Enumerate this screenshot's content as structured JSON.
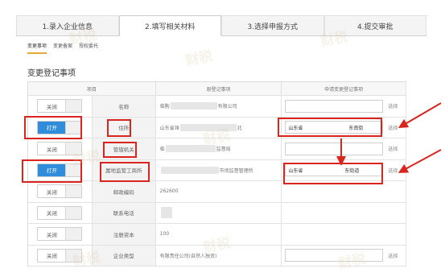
{
  "steps": [
    {
      "label": "1.录入企业信息",
      "active": false
    },
    {
      "label": "2.填写相关材料",
      "active": true
    },
    {
      "label": "3.选择申报方式",
      "active": false
    },
    {
      "label": "4.提交审批",
      "active": false
    }
  ],
  "subtabs": [
    {
      "label": "变更事项",
      "active": true
    },
    {
      "label": "变更备案",
      "active": false
    },
    {
      "label": "授权委托",
      "active": false
    }
  ],
  "section_title": "变更登记事项",
  "table": {
    "headers": [
      "项目",
      "原登记事项",
      "申请变更登记事项"
    ],
    "rows": [
      {
        "toggle": "关闭",
        "on": false,
        "field": "名称",
        "old": "临朐",
        "old_suffix": "有限公司",
        "new": "",
        "choose": "选择"
      },
      {
        "toggle": "打开",
        "on": true,
        "field": "住所",
        "old": "山东省潍",
        "old_suffix": "北",
        "new": "山东省",
        "new_suffix": "东南街",
        "choose": "选择"
      },
      {
        "toggle": "关闭",
        "on": false,
        "field": "管辖机关",
        "old": "临",
        "old_suffix": "监督局",
        "new": "",
        "choose": "选择"
      },
      {
        "toggle": "打开",
        "on": true,
        "field": "属地监管工商所",
        "old": "",
        "old_suffix": "市场监督管理所",
        "new": "山东省",
        "new_suffix": "东街道",
        "choose": "选择"
      },
      {
        "toggle": "关闭",
        "on": false,
        "field": "邮政编码",
        "old": "262600",
        "old_suffix": "",
        "new": "",
        "choose": ""
      },
      {
        "toggle": "关闭",
        "on": false,
        "field": "联系电话",
        "old": "",
        "old_suffix": "",
        "new": "",
        "choose": ""
      },
      {
        "toggle": "关闭",
        "on": false,
        "field": "注册资本",
        "old": "100",
        "old_suffix": "",
        "new": "",
        "choose": ""
      },
      {
        "toggle": "关闭",
        "on": false,
        "field": "企业类型",
        "old": "有限责任公司(自然人独资)",
        "old_suffix": "",
        "new": "",
        "choose": "选择"
      }
    ]
  },
  "watermark": {
    "brand": "财税",
    "sub": "联合财税"
  },
  "colors": {
    "highlight": "#d9251d",
    "toggle_on": "#2f8ddc",
    "tab_underline": "#e8a838"
  }
}
